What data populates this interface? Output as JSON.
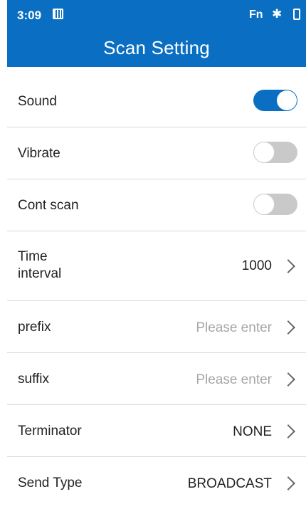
{
  "status_bar": {
    "time": "3:09",
    "sim_icon": "sim-card-icon",
    "fn_label": "Fn",
    "bluetooth_icon": "bluetooth-icon",
    "battery_icon": "battery-charging-icon"
  },
  "header": {
    "title": "Scan Setting",
    "color": "#0a6fc2"
  },
  "settings": {
    "sound": {
      "label": "Sound",
      "enabled": true
    },
    "vibrate": {
      "label": "Vibrate",
      "enabled": false
    },
    "cont_scan": {
      "label": "Cont scan",
      "enabled": false
    },
    "time_interval": {
      "label_line1": "Time",
      "label_line2": "interval",
      "value": "1000"
    },
    "prefix": {
      "label": "prefix",
      "placeholder": "Please enter"
    },
    "suffix": {
      "label": "suffix",
      "placeholder": "Please enter"
    },
    "terminator": {
      "label": "Terminator",
      "value": "NONE"
    },
    "send_type": {
      "label": "Send Type",
      "value": "BROADCAST"
    }
  },
  "colors": {
    "toggle_on": "#0a6fc2",
    "toggle_off": "#c9c9c9",
    "placeholder_text": "#a6a6a6",
    "divider": "#d8d8d8"
  }
}
